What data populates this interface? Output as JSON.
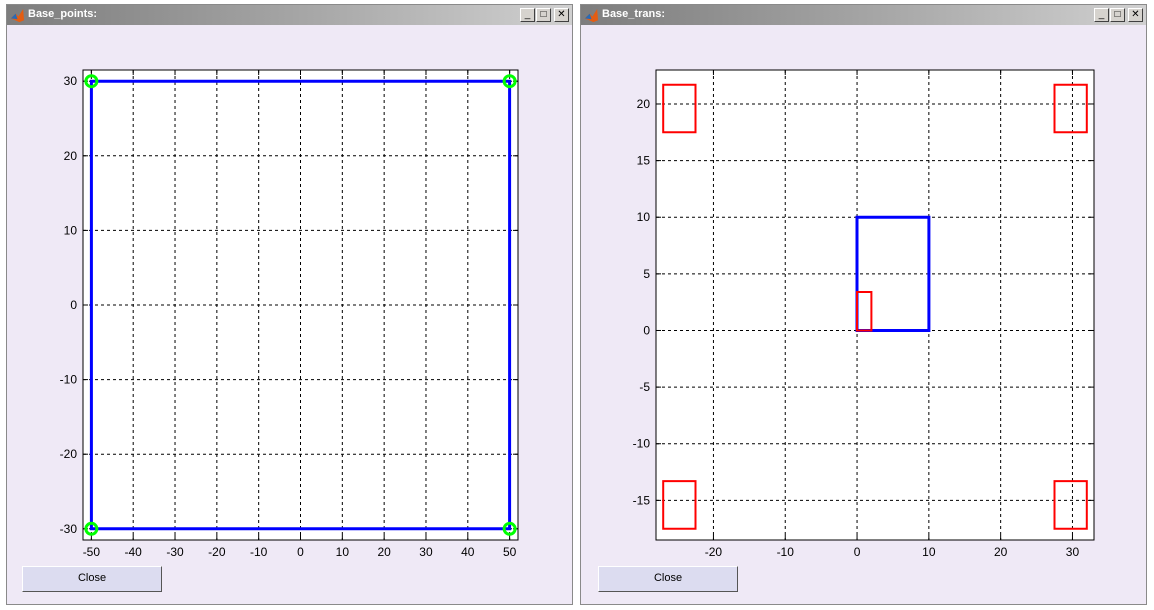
{
  "windows": [
    {
      "title": "Base_points:",
      "close_label": "Close",
      "chart_data": {
        "type": "line",
        "xlim": [
          -52,
          52
        ],
        "ylim": [
          -31.5,
          31.5
        ],
        "xticks": [
          -50,
          -40,
          -30,
          -20,
          -10,
          0,
          10,
          20,
          30,
          40,
          50
        ],
        "yticks": [
          -30,
          -20,
          -10,
          0,
          10,
          20,
          30
        ],
        "grid": true,
        "series": [
          {
            "kind": "polygon",
            "color": "#0000ff",
            "points": [
              [
                -50,
                -30
              ],
              [
                50,
                -30
              ],
              [
                50,
                30
              ],
              [
                -50,
                30
              ]
            ]
          },
          {
            "kind": "markers",
            "marker": "circle",
            "color": "#00ff00",
            "points": [
              [
                -50,
                30
              ],
              [
                50,
                30
              ],
              [
                -50,
                -30
              ],
              [
                50,
                -30
              ]
            ]
          }
        ]
      }
    },
    {
      "title": "Base_trans:",
      "close_label": "Close",
      "chart_data": {
        "type": "line",
        "xlim": [
          -28,
          33
        ],
        "ylim": [
          -18.5,
          23
        ],
        "xticks": [
          -20,
          -10,
          0,
          10,
          20,
          30
        ],
        "yticks": [
          -15,
          -10,
          -5,
          0,
          5,
          10,
          15,
          20
        ],
        "grid": true,
        "series": [
          {
            "kind": "polygon",
            "color": "#0000ff",
            "points": [
              [
                0,
                0
              ],
              [
                10,
                0
              ],
              [
                10,
                10
              ],
              [
                0,
                10
              ]
            ]
          },
          {
            "kind": "polygon",
            "color": "#ff0000",
            "points": [
              [
                0,
                0
              ],
              [
                2,
                0
              ],
              [
                2,
                3.4
              ],
              [
                0,
                3.4
              ]
            ]
          },
          {
            "kind": "polygon",
            "color": "#ff0000",
            "points": [
              [
                -27,
                17.5
              ],
              [
                -22.5,
                17.5
              ],
              [
                -22.5,
                21.7
              ],
              [
                -27,
                21.7
              ]
            ]
          },
          {
            "kind": "polygon",
            "color": "#ff0000",
            "points": [
              [
                27.5,
                17.5
              ],
              [
                32,
                17.5
              ],
              [
                32,
                21.7
              ],
              [
                27.5,
                21.7
              ]
            ]
          },
          {
            "kind": "polygon",
            "color": "#ff0000",
            "points": [
              [
                -27,
                -17.5
              ],
              [
                -22.5,
                -17.5
              ],
              [
                -22.5,
                -13.3
              ],
              [
                -27,
                -13.3
              ]
            ]
          },
          {
            "kind": "polygon",
            "color": "#ff0000",
            "points": [
              [
                27.5,
                -17.5
              ],
              [
                32,
                -17.5
              ],
              [
                32,
                -13.3
              ],
              [
                27.5,
                -13.3
              ]
            ]
          }
        ]
      }
    }
  ]
}
